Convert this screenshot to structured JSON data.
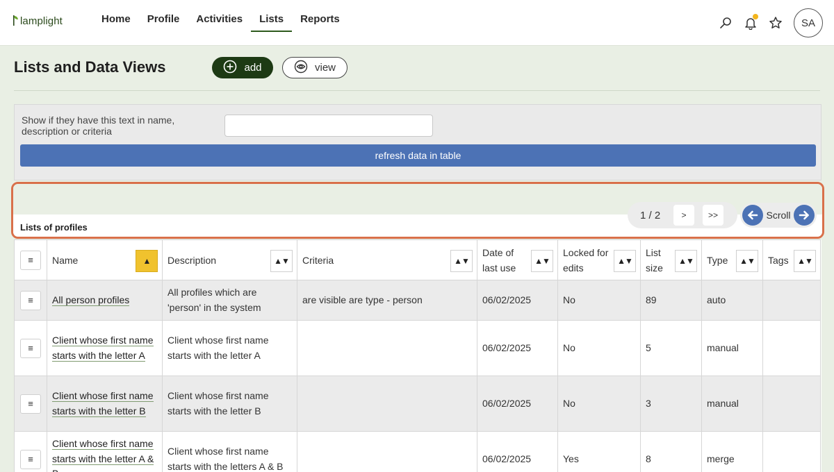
{
  "app": {
    "logo_text": "lamplight"
  },
  "nav": {
    "items": [
      {
        "label": "Home",
        "active": false
      },
      {
        "label": "Profile",
        "active": false
      },
      {
        "label": "Activities",
        "active": false
      },
      {
        "label": "Lists",
        "active": true
      },
      {
        "label": "Reports",
        "active": false
      }
    ],
    "icons": [
      "search-icon",
      "bell-icon",
      "star-icon"
    ],
    "notification_dot_color": "#f3b51d",
    "avatar_initials": "SA"
  },
  "page": {
    "title": "Lists and Data Views",
    "add_label": "add",
    "view_label": "view"
  },
  "filter": {
    "label": "Show if they have this text in name, description or criteria",
    "input_value": "",
    "refresh_label": "refresh data in table"
  },
  "toolbar": {
    "title": "Lists of profiles",
    "pager_text": "1 / 2",
    "next_label": ">",
    "last_label": ">>",
    "scroll_label": "Scroll",
    "highlight_color": "#d9704a"
  },
  "table": {
    "menu_glyph": "≡",
    "sort_glyph": "▲▼",
    "sort_active_glyph": "▲",
    "columns": [
      {
        "key": "menu",
        "label": ""
      },
      {
        "key": "name",
        "label": "Name",
        "sort_active": true
      },
      {
        "key": "description",
        "label": "Description"
      },
      {
        "key": "criteria",
        "label": "Criteria"
      },
      {
        "key": "date",
        "label": "Date of last use"
      },
      {
        "key": "locked",
        "label": "Locked for edits"
      },
      {
        "key": "size",
        "label": "List size"
      },
      {
        "key": "type",
        "label": "Type"
      },
      {
        "key": "tags",
        "label": "Tags"
      }
    ],
    "rows": [
      {
        "name": "All person profiles",
        "description": "All profiles which are 'person' in the system",
        "criteria": "are visible are type - person",
        "date": "06/02/2025",
        "locked": "No",
        "size": "89",
        "type": "auto",
        "tags": ""
      },
      {
        "name": "Client whose first name starts with the letter A",
        "description": "Client whose first name starts with the letter A",
        "criteria": "",
        "date": "06/02/2025",
        "locked": "No",
        "size": "5",
        "type": "manual",
        "tags": ""
      },
      {
        "name": "Client whose first name starts with the letter B",
        "description": "Client whose first name starts with the letter B",
        "criteria": "",
        "date": "06/02/2025",
        "locked": "No",
        "size": "3",
        "type": "manual",
        "tags": ""
      },
      {
        "name": "Client whose first name starts with the letter A & B",
        "description": "Client whose first name starts with the letters A & B",
        "criteria": "",
        "date": "06/02/2025",
        "locked": "Yes",
        "size": "8",
        "type": "merge",
        "tags": ""
      }
    ]
  }
}
